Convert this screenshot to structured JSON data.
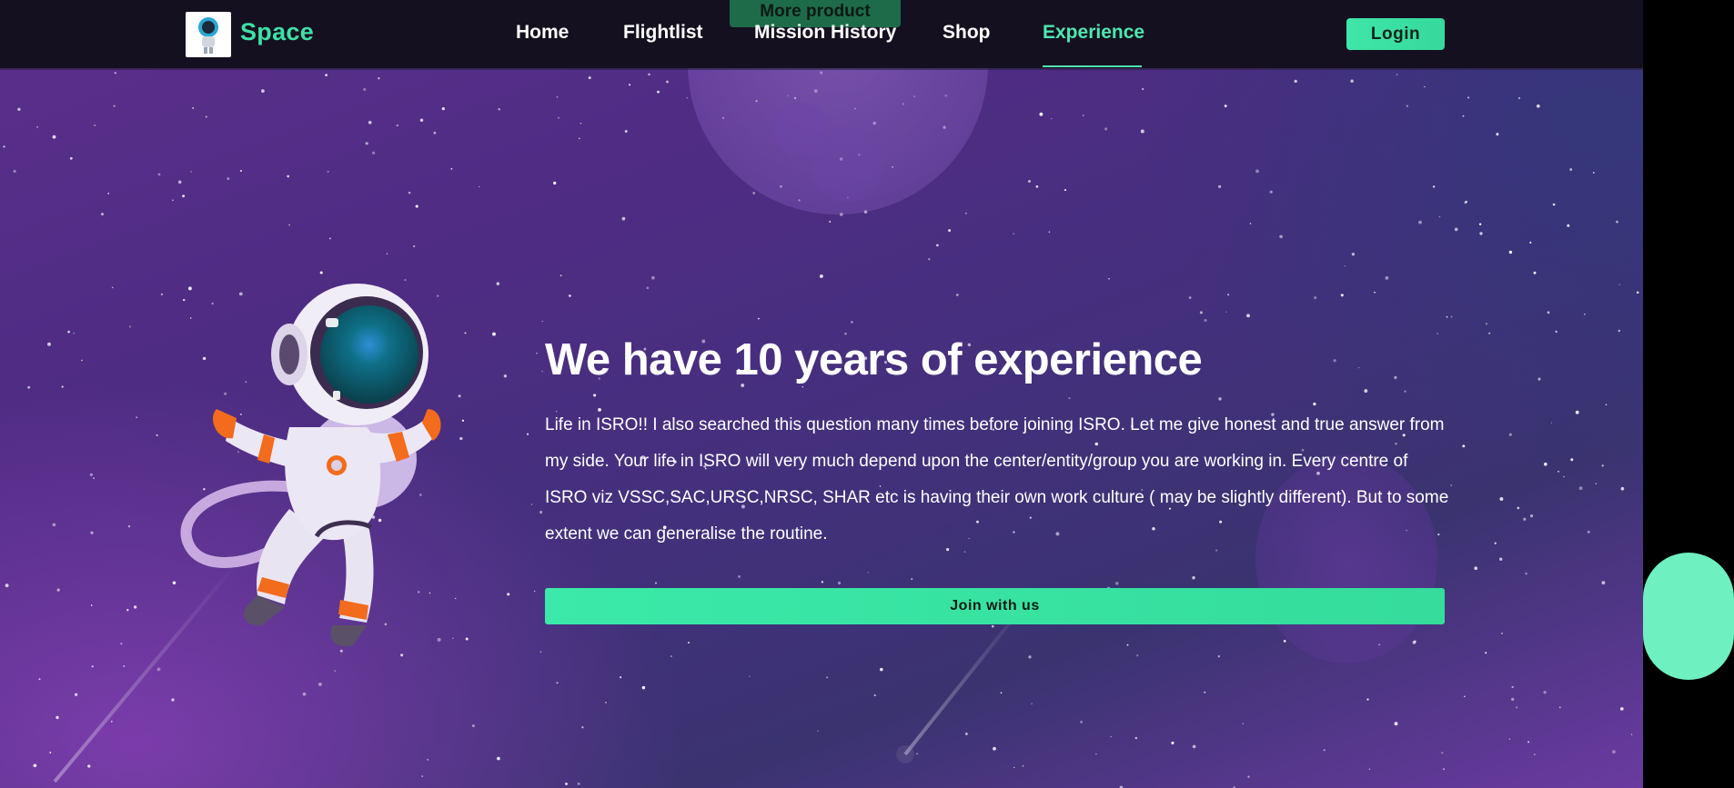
{
  "brand": {
    "name": "Space"
  },
  "nav": {
    "items": [
      {
        "label": "Home",
        "active": false
      },
      {
        "label": "Flightlist",
        "active": false
      },
      {
        "label": "Mission History",
        "active": false
      },
      {
        "label": "Shop",
        "active": false
      },
      {
        "label": "Experience",
        "active": true
      }
    ],
    "more_product_label": "More product",
    "login_label": "Login"
  },
  "hero": {
    "title": "We have 10 years of experience",
    "text": "Life in ISRO!! I also searched this question many times before joining ISRO. Let me give honest and true answer from my side. Your life in ISRO will very much depend upon the center/entity/group you are working in. Every centre of ISRO viz VSSC,SAC,URSC,NRSC, SHAR etc is having their own work culture ( may be slightly different). But to some extent we can generalise the routine.",
    "cta_label": "Join with us"
  },
  "colors": {
    "accent": "#3ee0a6",
    "nav_bg": "#15101f",
    "bg_purple": "#4f2c84"
  },
  "icons": {
    "logo": "astronaut-logo-icon",
    "illustration": "astronaut-illustration"
  }
}
